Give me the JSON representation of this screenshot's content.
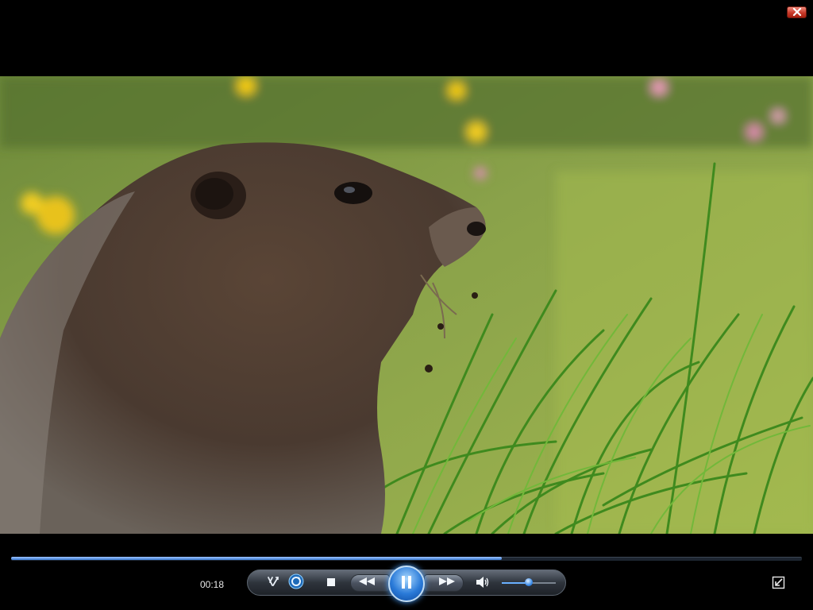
{
  "player": {
    "time_elapsed": "00:18",
    "progress_fraction": 0.62,
    "volume_fraction": 0.5,
    "state": "playing"
  },
  "icons": {
    "close": "close-icon",
    "shuffle": "shuffle-icon",
    "repeat": "repeat-icon",
    "stop": "stop-icon",
    "previous": "previous-icon",
    "play_pause": "pause-icon",
    "next": "next-icon",
    "volume": "volume-icon",
    "exit_fullscreen": "exit-fullscreen-icon"
  },
  "colors": {
    "accent": "#3a78d0",
    "close_button": "#c83a2a"
  }
}
